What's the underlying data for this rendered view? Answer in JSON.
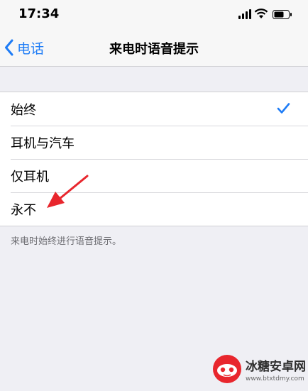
{
  "status_bar": {
    "time": "17:34",
    "icons": [
      "cellular-signal-icon",
      "wifi-icon",
      "battery-icon"
    ]
  },
  "nav": {
    "back_label": "电话",
    "title": "来电时语音提示"
  },
  "options": [
    {
      "label": "始终",
      "selected": true
    },
    {
      "label": "耳机与汽车",
      "selected": false
    },
    {
      "label": "仅耳机",
      "selected": false
    },
    {
      "label": "永不",
      "selected": false
    }
  ],
  "footer_note": "来电时始终进行语音提示。",
  "watermark": {
    "name": "冰糖安卓网",
    "url": "www.btxtdmy.com"
  },
  "colors": {
    "accent": "#1e7cf6",
    "background": "#efeff4",
    "annotation_arrow": "#e8262d"
  }
}
